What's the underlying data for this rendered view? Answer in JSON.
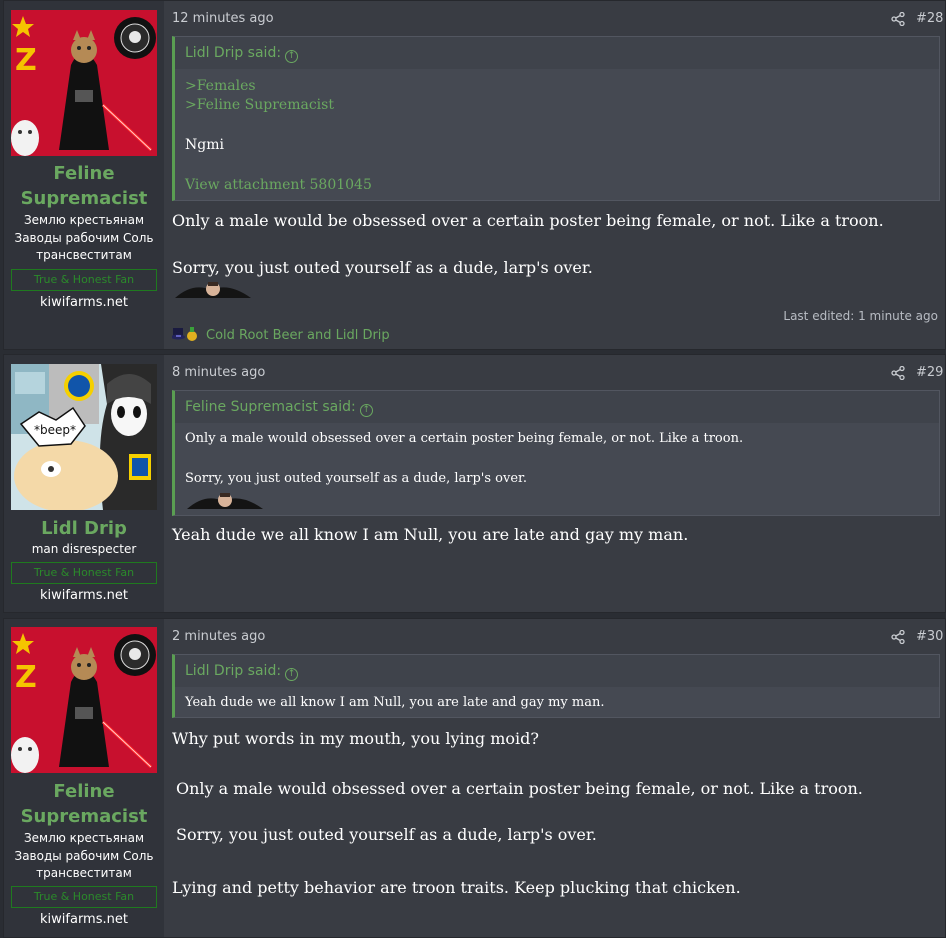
{
  "posts": [
    {
      "user": {
        "name_line1": "Feline",
        "name_line2": "Supremacist",
        "title_line1": "Землю крестьянам",
        "title_line2": "Заводы рабочим Соль",
        "title_line3": "трансвеститам",
        "banner": "True & Honest Fan",
        "site": "kiwifarms.net"
      },
      "time": "12 minutes ago",
      "number": "#28",
      "quote": {
        "author": "Lidl Drip said:",
        "lines": [
          ">Females",
          ">Feline Supremacist",
          "Ngmi",
          "View attachment 5801045"
        ]
      },
      "body": [
        "Only a male would be obsessed over a certain poster being female, or not. Like a troon.",
        "Sorry, you just outed yourself as a dude, larp's over."
      ],
      "edited": "Last edited: 1 minute ago",
      "reactions": "Cold Root Beer and Lidl Drip"
    },
    {
      "user": {
        "name_line1": "Lidl Drip",
        "title_line1": "man disrespecter",
        "banner": "True & Honest Fan",
        "site": "kiwifarms.net",
        "avatar_text": "*beep*"
      },
      "time": "8 minutes ago",
      "number": "#29",
      "quote": {
        "author": "Feline Supremacist said:",
        "lines": [
          "Only a male would obsessed over a certain poster being female, or not. Like a troon.",
          "Sorry, you just outed yourself as a dude, larp's over."
        ]
      },
      "body": [
        "Yeah dude we all know I am Null, you are late and gay my man."
      ]
    },
    {
      "user": {
        "name_line1": "Feline",
        "name_line2": "Supremacist",
        "title_line1": "Землю крестьянам",
        "title_line2": "Заводы рабочим Соль",
        "title_line3": "трансвеститам",
        "banner": "True & Honest Fan",
        "site": "kiwifarms.net"
      },
      "time": "2 minutes ago",
      "number": "#30",
      "quote": {
        "author": "Lidl Drip said:",
        "lines": [
          "Yeah dude we all know I am Null, you are late and gay my man."
        ]
      },
      "body": [
        "Why put words in my mouth, you lying moid?",
        "Only a male would obsessed over a certain poster being female, or not. Like a troon.",
        "Sorry, you just outed yourself as a dude, larp's over.",
        "Lying and petty behavior are troon traits. Keep plucking that chicken."
      ]
    }
  ],
  "colors": {
    "accent": "#6aa860",
    "post_bg": "#393c43",
    "sidebar_bg": "#30333a",
    "page_bg": "#2a2d33"
  },
  "icons": [
    "share-icon",
    "quote-jump-icon",
    "reaction-icon",
    "avatar-image",
    "sticker-image"
  ]
}
